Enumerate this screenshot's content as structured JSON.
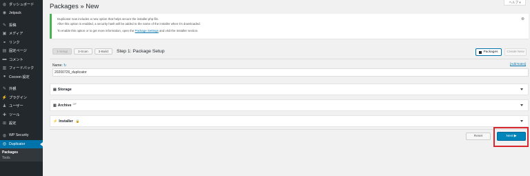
{
  "sidebar": {
    "items": [
      {
        "icon": "dashboard-icon",
        "glyph": "◍",
        "label": "ダッシュボード"
      },
      {
        "icon": "jetpack-icon",
        "glyph": "◉",
        "label": "Jetpack"
      },
      {
        "icon": "pin-icon",
        "glyph": "✎",
        "label": "投稿"
      },
      {
        "icon": "media-icon",
        "glyph": "▣",
        "label": "メディア"
      },
      {
        "icon": "link-icon",
        "glyph": "⚭",
        "label": "リンク"
      },
      {
        "icon": "page-icon",
        "glyph": "▤",
        "label": "固定ページ"
      },
      {
        "icon": "comment-icon",
        "glyph": "▬",
        "label": "コメント"
      },
      {
        "icon": "feedback-icon",
        "glyph": "▥",
        "label": "フィードバック"
      },
      {
        "icon": "cocoon-icon",
        "glyph": "●",
        "label": "Cocoon 設定"
      },
      {
        "icon": "appearance-icon",
        "glyph": "✎",
        "label": "外観"
      },
      {
        "icon": "plugin-icon",
        "glyph": "⚡",
        "label": "プラグイン"
      },
      {
        "icon": "users-icon",
        "glyph": "♟",
        "label": "ユーザー"
      },
      {
        "icon": "tools-icon",
        "glyph": "✚",
        "label": "ツール"
      },
      {
        "icon": "settings-icon",
        "glyph": "⊞",
        "label": "設定"
      },
      {
        "icon": "wp-security-icon",
        "glyph": "◍",
        "label": "WP Security"
      },
      {
        "icon": "duplicator-icon",
        "glyph": "◎",
        "label": "Duplicator"
      }
    ],
    "sub_active": "Packages",
    "sub_next": "Tools"
  },
  "header": {
    "title": "Packages » New",
    "help_tab": "ヘルプ ▾"
  },
  "notice": {
    "line1": "Duplicator now includes a new option that helps secure the installer.php file.",
    "line2": "After this option is enabled, a security hash will be added to the name of the installer when it's downloaded.",
    "line3_before": "To enable this option or to get more information, open the",
    "line3_link": "Package Settings",
    "line3_after": "and visit the Installer section.",
    "dismiss": "⊗"
  },
  "steps": {
    "items": [
      "1-Setup",
      "2-Scan",
      "3-Build"
    ],
    "title": "Step 1: Package Setup"
  },
  "buttons": {
    "packages": "Packages",
    "create_new": "Create New",
    "reset": "Reset",
    "next": "Next ▶"
  },
  "form": {
    "name_label": "Name:",
    "refresh_glyph": "↻",
    "add_notes": "[Add Notes]",
    "name_value": "20200726_duplicator"
  },
  "panels": {
    "storage": "Storage",
    "archive": "Archive",
    "archive_sup": "ZIP",
    "installer": "Installer",
    "lock_glyph": "🔒"
  }
}
